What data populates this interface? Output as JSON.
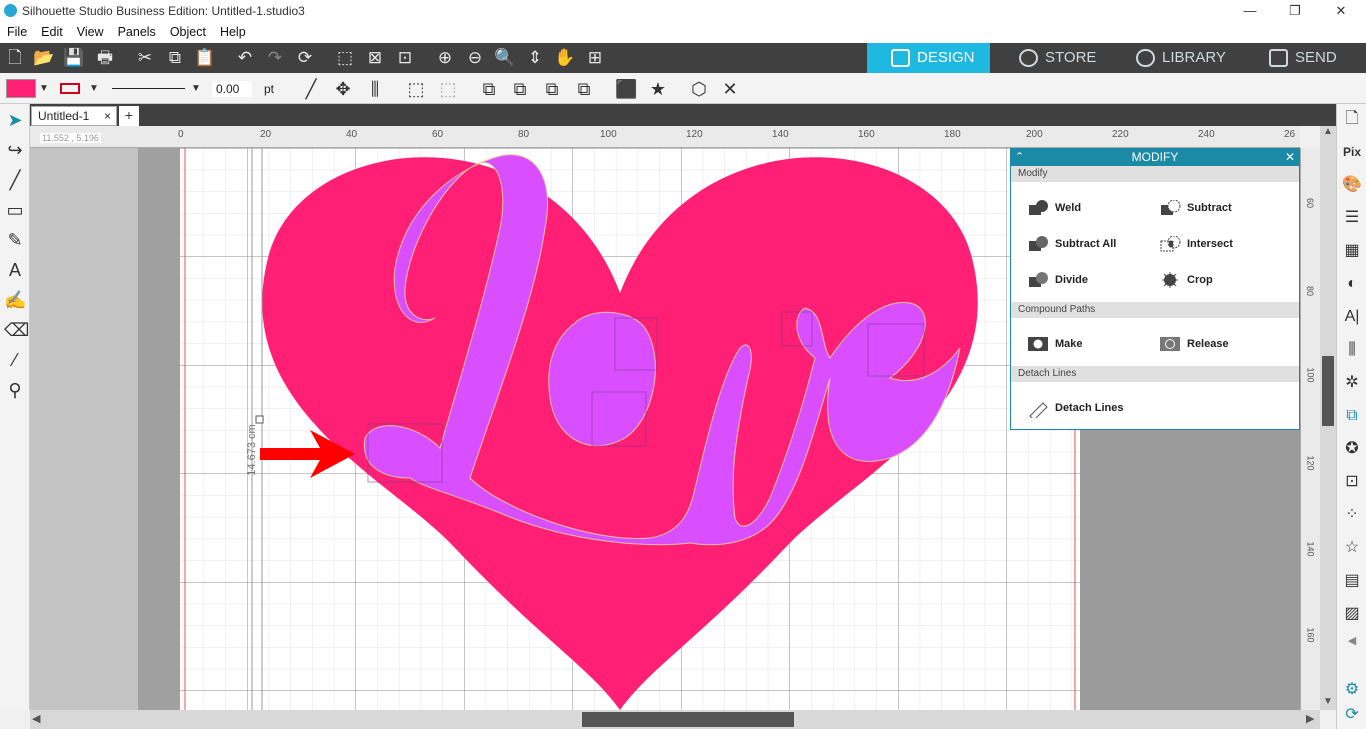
{
  "window": {
    "title": "Silhouette Studio Business Edition: Untitled-1.studio3",
    "controls": [
      "—",
      "❐",
      "✕"
    ]
  },
  "menu": [
    "File",
    "Edit",
    "View",
    "Panels",
    "Object",
    "Help"
  ],
  "modes": {
    "design": "DESIGN",
    "store": "STORE",
    "library": "LIBRARY",
    "send": "SEND",
    "active": "DESIGN"
  },
  "properties": {
    "fill_color": "#ff1f74",
    "line_color": "#d0021b",
    "line_width": "0.00",
    "line_unit": "pt"
  },
  "document": {
    "tab_label": "Untitled-1",
    "close": "×",
    "new_tab": "+"
  },
  "ruler": {
    "coordinates": "11.552 , 5.196",
    "top_ticks": [
      "0",
      "20",
      "40",
      "60",
      "80",
      "100",
      "120",
      "140",
      "160",
      "180",
      "200",
      "220",
      "240",
      "26"
    ],
    "right_ticks": [
      "60",
      "80",
      "100",
      "120",
      "140",
      "160"
    ]
  },
  "canvas": {
    "dimension_label": "14.673 cm",
    "heart_color": "#ff1f74",
    "text_art": "love",
    "text_color": "#d94fff",
    "arrow_color": "#ff0000"
  },
  "modify_panel": {
    "title": "MODIFY",
    "modify_section": "Modify",
    "weld": "Weld",
    "subtract": "Subtract",
    "subtract_all": "Subtract All",
    "intersect": "Intersect",
    "divide": "Divide",
    "crop": "Crop",
    "compound_section": "Compound Paths",
    "make": "Make",
    "release": "Release",
    "detach_section": "Detach Lines",
    "detach": "Detach Lines",
    "accent_color": "#1a8aa6"
  }
}
